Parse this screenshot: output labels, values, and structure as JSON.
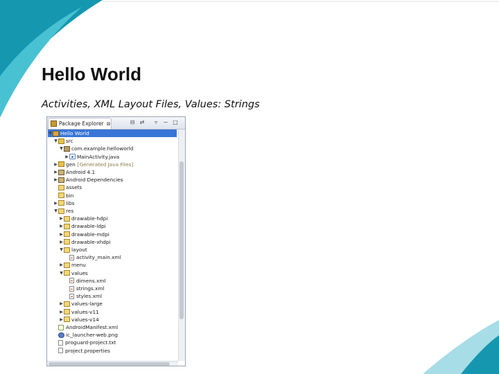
{
  "slide": {
    "title": "Hello World",
    "subtitle": "Activities, XML Layout Files, Values: Strings",
    "colors": {
      "teal_dark": "#1597b0",
      "teal_light": "#48c2d2",
      "accent_pale": "#a7dde6"
    }
  },
  "explorer": {
    "tab_label": "Package Explorer",
    "tab_close": "⊠",
    "toolbar_icons": [
      "collapse-all-icon",
      "link-with-editor-icon",
      "view-menu-icon",
      "minimize-icon",
      "maximize-icon"
    ],
    "rows": [
      {
        "label": "Hello World",
        "icon": "project-icon",
        "arrow": "▼",
        "selected": true
      },
      {
        "label": "src",
        "icon": "source-folder-icon",
        "arrow": "▼"
      },
      {
        "label": "com.example.helloworld",
        "icon": "package-icon",
        "arrow": "▼"
      },
      {
        "label": "MainActivity.java",
        "icon": "java-file-icon",
        "arrow": "▶"
      },
      {
        "label": "gen",
        "note": "[Generated Java Files]",
        "icon": "source-folder-icon",
        "arrow": "▶"
      },
      {
        "label": "Android 4.1",
        "icon": "library-icon",
        "arrow": "▶"
      },
      {
        "label": "Android Dependencies",
        "icon": "library-icon",
        "arrow": "▶"
      },
      {
        "label": "assets",
        "icon": "folder-icon",
        "arrow": ""
      },
      {
        "label": "bin",
        "icon": "folder-icon",
        "arrow": ""
      },
      {
        "label": "libs",
        "icon": "folder-icon",
        "arrow": "▶"
      },
      {
        "label": "res",
        "icon": "folder-icon",
        "arrow": "▼"
      },
      {
        "label": "drawable-hdpi",
        "icon": "folder-icon",
        "arrow": "▶"
      },
      {
        "label": "drawable-ldpi",
        "icon": "folder-icon",
        "arrow": "▶"
      },
      {
        "label": "drawable-mdpi",
        "icon": "folder-icon",
        "arrow": "▶"
      },
      {
        "label": "drawable-xhdpi",
        "icon": "folder-icon",
        "arrow": "▶"
      },
      {
        "label": "layout",
        "icon": "folder-icon",
        "arrow": "▼"
      },
      {
        "label": "activity_main.xml",
        "icon": "xml-file-icon",
        "arrow": ""
      },
      {
        "label": "menu",
        "icon": "folder-icon",
        "arrow": "▶"
      },
      {
        "label": "values",
        "icon": "folder-icon",
        "arrow": "▼"
      },
      {
        "label": "dimens.xml",
        "icon": "xml-file-icon",
        "arrow": ""
      },
      {
        "label": "strings.xml",
        "icon": "xml-file-icon",
        "arrow": ""
      },
      {
        "label": "styles.xml",
        "icon": "xml-file-icon",
        "arrow": ""
      },
      {
        "label": "values-large",
        "icon": "folder-icon",
        "arrow": "▶"
      },
      {
        "label": "values-v11",
        "icon": "folder-icon",
        "arrow": "▶"
      },
      {
        "label": "values-v14",
        "icon": "folder-icon",
        "arrow": "▶"
      },
      {
        "label": "AndroidManifest.xml",
        "icon": "android-manifest-icon",
        "arrow": ""
      },
      {
        "label": "ic_launcher-web.png",
        "icon": "image-file-icon",
        "arrow": ""
      },
      {
        "label": "proguard-project.txt",
        "icon": "text-file-icon",
        "arrow": ""
      },
      {
        "label": "project.properties",
        "icon": "text-file-icon",
        "arrow": ""
      }
    ]
  }
}
